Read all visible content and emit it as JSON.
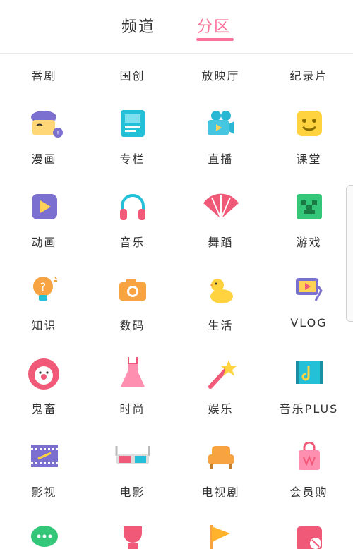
{
  "tabs": [
    {
      "label": "频道"
    },
    {
      "label": "分区"
    }
  ],
  "rows": [
    [
      "番剧",
      "国创",
      "放映厅",
      "纪录片"
    ],
    [
      "漫画",
      "专栏",
      "直播",
      "课堂"
    ],
    [
      "动画",
      "音乐",
      "舞蹈",
      "游戏"
    ],
    [
      "知识",
      "数码",
      "生活",
      "VLOG"
    ],
    [
      "鬼畜",
      "时尚",
      "娱乐",
      "音乐PLUS"
    ],
    [
      "影视",
      "电影",
      "电视剧",
      "会员购"
    ]
  ],
  "icons": [
    [
      "tv-icon",
      "guochuang-icon",
      "cinema-icon",
      "documentary-icon"
    ],
    [
      "comic-icon",
      "column-icon",
      "live-camera-icon",
      "classroom-icon"
    ],
    [
      "anime-icon",
      "headphones-icon",
      "fan-icon",
      "game-icon"
    ],
    [
      "lightbulb-icon",
      "camera-icon",
      "duck-icon",
      "vlog-icon"
    ],
    [
      "clown-icon",
      "dress-icon",
      "magic-wand-icon",
      "music-plus-icon"
    ],
    [
      "film-icon",
      "3d-glasses-icon",
      "sofa-icon",
      "shopping-bag-icon"
    ],
    [
      "chat-bubble-icon",
      "trophy-icon",
      "flag-icon",
      "ticket-icon"
    ]
  ],
  "colors": {
    "accent": "#fb7299",
    "text": "#333333"
  }
}
